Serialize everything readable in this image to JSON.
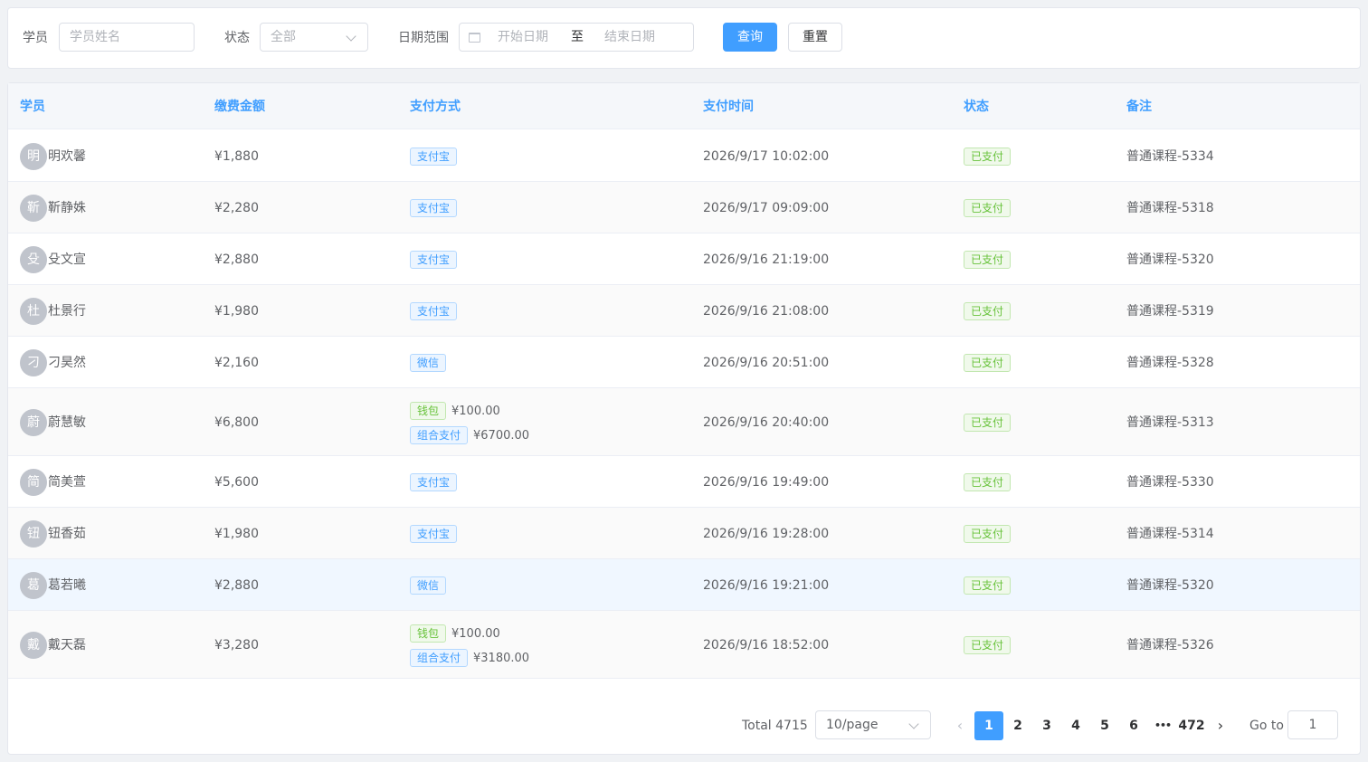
{
  "filters": {
    "student_label": "学员",
    "student_placeholder": "学员姓名",
    "status_label": "状态",
    "status_value": "全部",
    "date_label": "日期范围",
    "start_placeholder": "开始日期",
    "range_sep": "至",
    "end_placeholder": "结束日期",
    "query_button": "查询",
    "reset_button": "重置"
  },
  "table": {
    "headers": [
      "学员",
      "缴费金额",
      "支付方式",
      "支付时间",
      "状态",
      "备注"
    ],
    "rows": [
      {
        "avatar": "明",
        "name": "明欢馨",
        "amount": "¥1,880",
        "payments": [
          {
            "method": "支付宝",
            "color": "blue"
          }
        ],
        "time": "2026/9/17 10:02:00",
        "status": "已支付",
        "note": "普通课程-5334"
      },
      {
        "avatar": "靳",
        "name": "靳静姝",
        "amount": "¥2,280",
        "payments": [
          {
            "method": "支付宝",
            "color": "blue"
          }
        ],
        "time": "2026/9/17 09:09:00",
        "status": "已支付",
        "note": "普通课程-5318"
      },
      {
        "avatar": "殳",
        "name": "殳文宣",
        "amount": "¥2,880",
        "payments": [
          {
            "method": "支付宝",
            "color": "blue"
          }
        ],
        "time": "2026/9/16 21:19:00",
        "status": "已支付",
        "note": "普通课程-5320"
      },
      {
        "avatar": "杜",
        "name": "杜景行",
        "amount": "¥1,980",
        "payments": [
          {
            "method": "支付宝",
            "color": "blue"
          }
        ],
        "time": "2026/9/16 21:08:00",
        "status": "已支付",
        "note": "普通课程-5319"
      },
      {
        "avatar": "刁",
        "name": "刁昊然",
        "amount": "¥2,160",
        "payments": [
          {
            "method": "微信",
            "color": "blue"
          }
        ],
        "time": "2026/9/16 20:51:00",
        "status": "已支付",
        "note": "普通课程-5328"
      },
      {
        "avatar": "蔚",
        "name": "蔚慧敏",
        "amount": "¥6,800",
        "payments": [
          {
            "method": "钱包",
            "color": "green",
            "amount": "¥100.00"
          },
          {
            "method": "组合支付",
            "color": "blue",
            "amount": "¥6700.00"
          }
        ],
        "time": "2026/9/16 20:40:00",
        "status": "已支付",
        "note": "普通课程-5313"
      },
      {
        "avatar": "简",
        "name": "简美萱",
        "amount": "¥5,600",
        "payments": [
          {
            "method": "支付宝",
            "color": "blue"
          }
        ],
        "time": "2026/9/16 19:49:00",
        "status": "已支付",
        "note": "普通课程-5330"
      },
      {
        "avatar": "钮",
        "name": "钮香茹",
        "amount": "¥1,980",
        "payments": [
          {
            "method": "支付宝",
            "color": "blue"
          }
        ],
        "time": "2026/9/16 19:28:00",
        "status": "已支付",
        "note": "普通课程-5314"
      },
      {
        "avatar": "葛",
        "name": "葛若曦",
        "amount": "¥2,880",
        "payments": [
          {
            "method": "微信",
            "color": "blue"
          }
        ],
        "time": "2026/9/16 19:21:00",
        "status": "已支付",
        "note": "普通课程-5320"
      },
      {
        "avatar": "戴",
        "name": "戴天磊",
        "amount": "¥3,280",
        "payments": [
          {
            "method": "钱包",
            "color": "green",
            "amount": "¥100.00"
          },
          {
            "method": "组合支付",
            "color": "blue",
            "amount": "¥3180.00"
          }
        ],
        "time": "2026/9/16 18:52:00",
        "status": "已支付",
        "note": "普通课程-5326"
      }
    ]
  },
  "pagination": {
    "total_text": "Total 4715",
    "page_size": "10/page",
    "pages": [
      "1",
      "2",
      "3",
      "4",
      "5",
      "6"
    ],
    "ellipsis": "•••",
    "last_page": "472",
    "current_page": "1",
    "goto_label": "Go to",
    "goto_value": "1",
    "prev_icon": "‹",
    "next_icon": "›"
  },
  "colors": {
    "primary": "#409eff",
    "success": "#67c23a",
    "text": "#606266"
  }
}
